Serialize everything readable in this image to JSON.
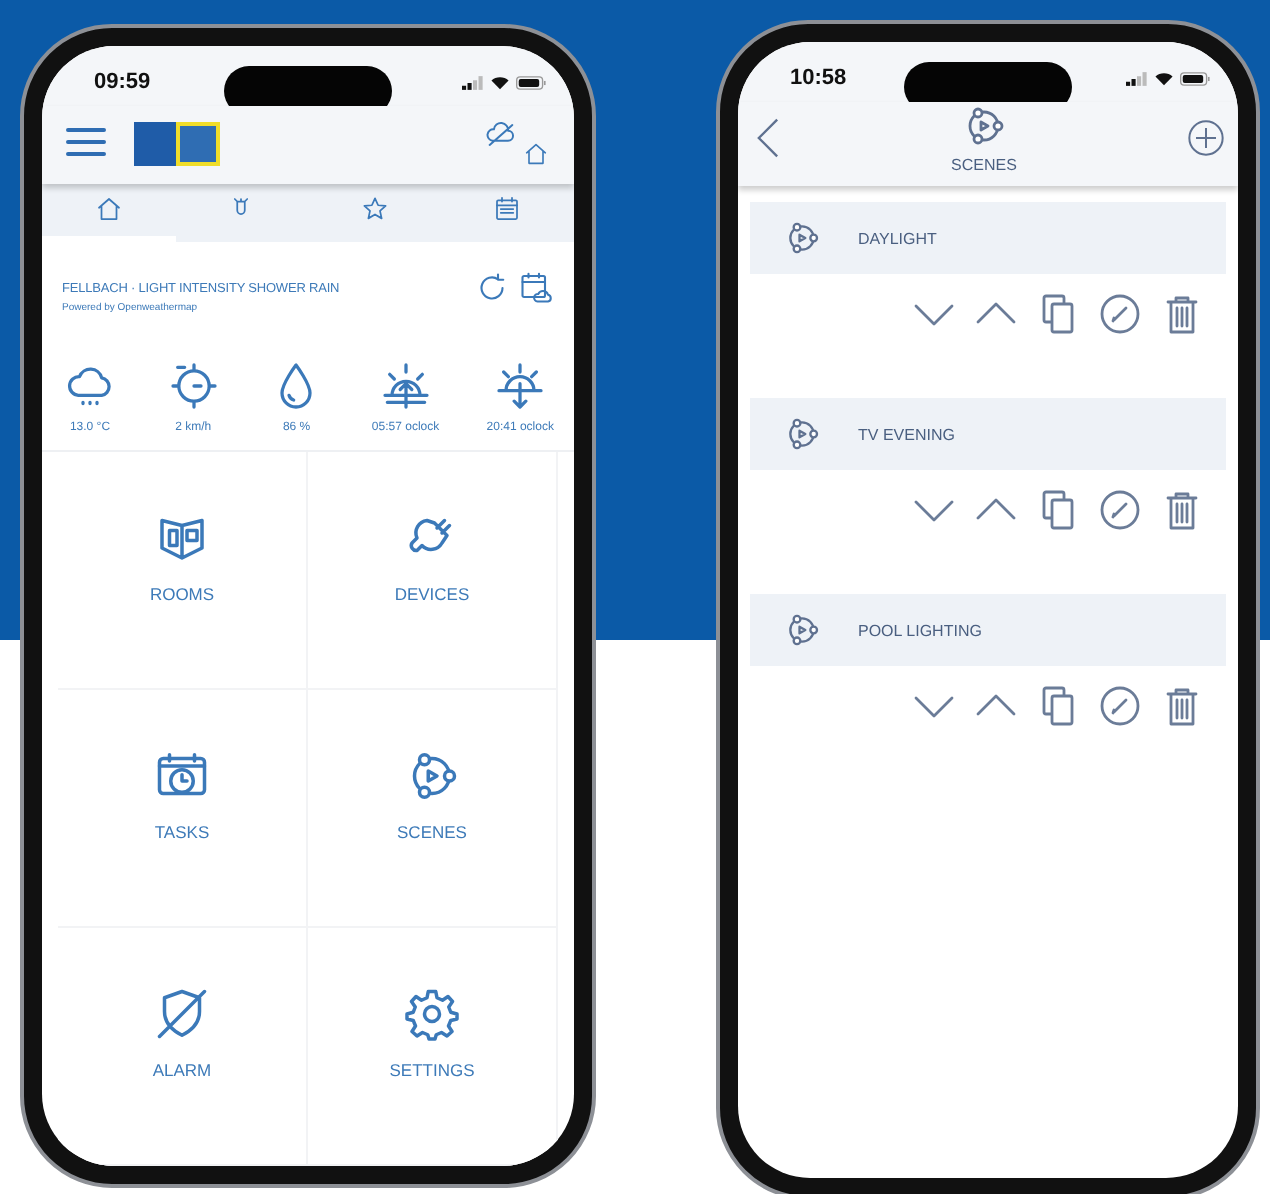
{
  "home_screen": {
    "status_bar": {
      "time": "09:59"
    },
    "tabs": [
      {
        "kind": "home",
        "selected": true
      },
      {
        "kind": "sensor",
        "selected": false
      },
      {
        "kind": "star",
        "selected": false
      },
      {
        "kind": "calendar",
        "selected": false
      }
    ],
    "weather": {
      "title": "FELLBACH · LIGHT INTENSITY SHOWER RAIN",
      "credit": "Powered by Openweathermap",
      "readings": [
        {
          "kind": "cloud",
          "value": "13.0 °C"
        },
        {
          "kind": "wind",
          "value": "2 km/h"
        },
        {
          "kind": "drop",
          "value": "86 %"
        },
        {
          "kind": "sunrise",
          "value": "05:57 oclock"
        },
        {
          "kind": "sunset",
          "value": "20:41 oclock"
        }
      ]
    },
    "tiles": [
      {
        "kind": "rooms",
        "label": "ROOMS"
      },
      {
        "kind": "devices",
        "label": "DEVICES"
      },
      {
        "kind": "tasks",
        "label": "TASKS"
      },
      {
        "kind": "scenes",
        "label": "SCENES"
      },
      {
        "kind": "alarm",
        "label": "ALARM"
      },
      {
        "kind": "settings",
        "label": "SETTINGS"
      }
    ]
  },
  "scenes_screen": {
    "status_bar": {
      "time": "10:58"
    },
    "title": "SCENES",
    "scenes": [
      {
        "name": "DAYLIGHT"
      },
      {
        "name": "TV EVENING"
      },
      {
        "name": "POOL LIGHTING"
      }
    ]
  }
}
